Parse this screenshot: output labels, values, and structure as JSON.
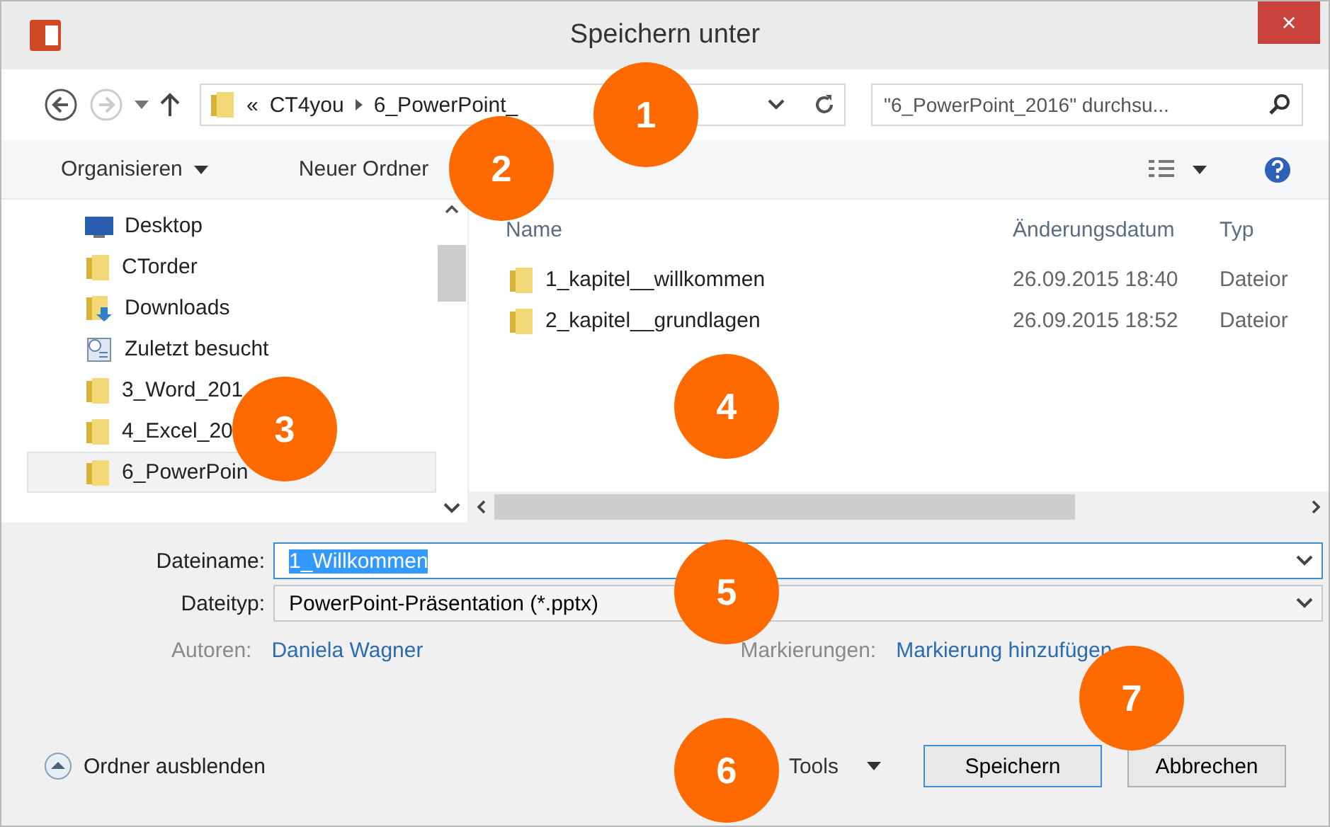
{
  "window": {
    "title": "Speichern unter",
    "close": "×"
  },
  "address": {
    "crumbs": [
      "«",
      "CT4you",
      "6_PowerPoint_"
    ],
    "search_placeholder": "\"6_PowerPoint_2016\" durchsu..."
  },
  "toolbar": {
    "organize": "Organisieren",
    "new_folder": "Neuer Ordner"
  },
  "sidebar": {
    "items": [
      {
        "label": "Desktop",
        "kind": "desktop",
        "selected": false
      },
      {
        "label": "CTorder",
        "kind": "folder",
        "selected": false
      },
      {
        "label": "Downloads",
        "kind": "downloads",
        "selected": false
      },
      {
        "label": "Zuletzt besucht",
        "kind": "recent",
        "selected": false
      },
      {
        "label": "3_Word_201",
        "kind": "folder",
        "selected": false
      },
      {
        "label": "4_Excel_20",
        "kind": "folder",
        "selected": false
      },
      {
        "label": "6_PowerPoin",
        "kind": "folder",
        "selected": true
      }
    ]
  },
  "table": {
    "columns": [
      "Name",
      "Änderungsdatum",
      "Typ"
    ],
    "rows": [
      {
        "name": "1_kapitel__willkommen",
        "date": "26.09.2015 18:40",
        "type": "Dateior"
      },
      {
        "name": "2_kapitel__grundlagen",
        "date": "26.09.2015 18:52",
        "type": "Dateior"
      }
    ]
  },
  "form": {
    "filename_label": "Dateiname:",
    "filename": "1_Willkommen",
    "filetype_label": "Dateityp:",
    "filetype": "PowerPoint-Präsentation (*.pptx)",
    "authors_label": "Autoren:",
    "authors": "Daniela Wagner",
    "tags_label": "Markierungen:",
    "tags": "Markierung hinzufügen"
  },
  "footer": {
    "hide_folders": "Ordner ausblenden",
    "tools": "Tools",
    "save": "Speichern",
    "cancel": "Abbrechen"
  },
  "callouts": [
    "1",
    "2",
    "3",
    "4",
    "5",
    "6",
    "7"
  ]
}
